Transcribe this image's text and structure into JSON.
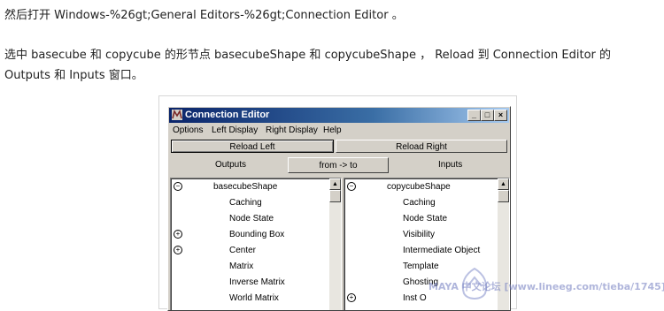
{
  "paragraph1": "然后打开 Windows-%26gt;General Editors-%26gt;Connection Editor 。",
  "paragraph2": "选中 basecube 和 copycube 的形节点 basecubeShape 和 copycubeShape ， Reload 到 Connection Editor 的 Outputs 和 Inputs 窗口。",
  "window": {
    "title": "Connection Editor",
    "min_glyph": "_",
    "max_glyph": "□",
    "close_glyph": "×"
  },
  "menu": [
    "Options",
    "Left Display",
    "Right Display",
    "Help"
  ],
  "buttons": {
    "reload_left": "Reload Left",
    "reload_right": "Reload Right",
    "from_to": "from -> to"
  },
  "headers": {
    "outputs": "Outputs",
    "inputs": "Inputs"
  },
  "left_list": {
    "node": "basecubeShape",
    "items": [
      {
        "label": "Caching",
        "expander": ""
      },
      {
        "label": "Node State",
        "expander": ""
      },
      {
        "label": "Bounding Box",
        "expander": "+"
      },
      {
        "label": "Center",
        "expander": "+"
      },
      {
        "label": "Matrix",
        "expander": ""
      },
      {
        "label": "Inverse Matrix",
        "expander": ""
      },
      {
        "label": "World Matrix",
        "expander": ""
      }
    ]
  },
  "right_list": {
    "node": "copycubeShape",
    "items": [
      {
        "label": "Caching",
        "expander": ""
      },
      {
        "label": "Node State",
        "expander": ""
      },
      {
        "label": "Visibility",
        "expander": ""
      },
      {
        "label": "Intermediate Object",
        "expander": ""
      },
      {
        "label": "Template",
        "expander": ""
      },
      {
        "label": "Ghosting",
        "expander": ""
      },
      {
        "label": "Inst O",
        "expander": "+"
      }
    ]
  },
  "watermark": "MAYA 中文论坛 [www.lineeg.com/tieba/1745]",
  "colors": {
    "titlebar_start": "#0a246a",
    "titlebar_end": "#a6caf0",
    "face": "#d4d0c8"
  }
}
